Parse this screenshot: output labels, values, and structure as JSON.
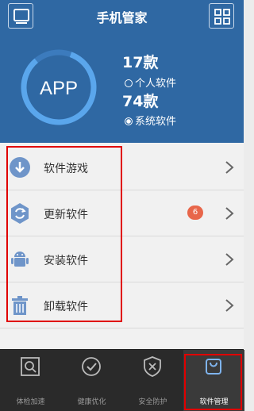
{
  "header": {
    "title": "手机管家",
    "left_icon": "phone-icon",
    "right_icon": "grid-icon"
  },
  "hero": {
    "ring_label": "APP",
    "personal_count": "17款",
    "personal_label": "个人软件",
    "system_count": "74款",
    "system_label": "系统软件",
    "selected": "system"
  },
  "list": {
    "items": [
      {
        "label": "软件游戏",
        "icon": "download-icon"
      },
      {
        "label": "更新软件",
        "icon": "refresh-icon",
        "badge": "6"
      },
      {
        "label": "安装软件",
        "icon": "android-icon"
      },
      {
        "label": "卸载软件",
        "icon": "trash-icon"
      }
    ]
  },
  "tabs": [
    {
      "label": "体检加速",
      "icon": "scan-icon"
    },
    {
      "label": "健康优化",
      "icon": "check-icon"
    },
    {
      "label": "安全防护",
      "icon": "shield-icon"
    },
    {
      "label": "软件管理",
      "icon": "bag-icon",
      "active": true
    }
  ],
  "colors": {
    "header_bg": "#2f68a3",
    "ring": "#5aa6ec",
    "badge": "#e8664a",
    "highlight": "#e00000",
    "tabbar_bg": "#2a2a2a"
  }
}
